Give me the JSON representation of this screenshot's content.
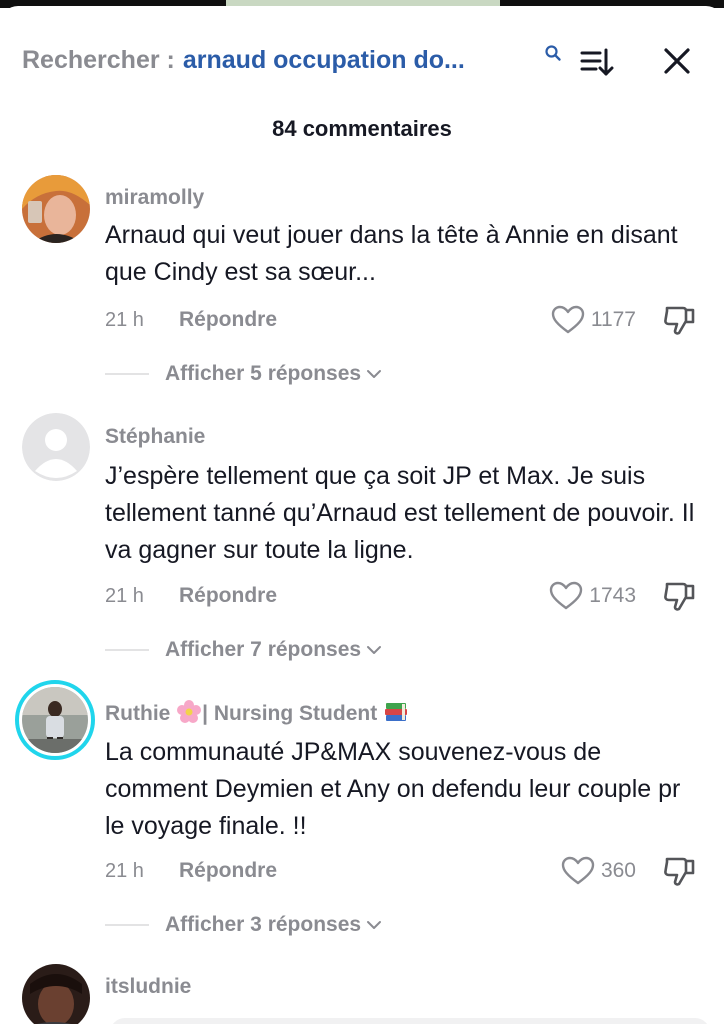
{
  "header": {
    "search_prefix": "Rechercher :",
    "search_query": "arnaud occupation do...",
    "comment_count": "84 commentaires"
  },
  "comments": [
    {
      "author": "miramolly",
      "text": "Arnaud qui veut jouer dans la tête à Annie en disant que Cindy est sa sœur...",
      "time": "21 h",
      "reply_label": "Répondre",
      "likes": "1177",
      "replies_label": "Afficher 5 réponses"
    },
    {
      "author": "Stéphanie",
      "text": "J’espère tellement que ça soit JP et Max. Je suis tellement tanné qu’Arnaud est tellement de pouvoir. Il va gagner sur toute la ligne.",
      "time": "21 h",
      "reply_label": "Répondre",
      "likes": "1743",
      "replies_label": "Afficher 7 réponses"
    },
    {
      "author_part1": "Ruthie ",
      "author_part2": "| Nursing Student ",
      "text": "La communauté JP&MAX souvenez-vous de comment Deymien et Any on defendu leur couple pr le voyage finale. !!",
      "time": "21 h",
      "reply_label": "Répondre",
      "likes": "360",
      "replies_label": "Afficher 3 réponses"
    },
    {
      "author": "itsludnie"
    }
  ],
  "colors": {
    "muted_text": "#8a8b91",
    "query_blue": "#2b5ca8",
    "story_ring": "#20d5ec"
  },
  "icons": [
    "search-icon",
    "sort-icon",
    "close-icon",
    "heart-icon",
    "dislike-icon",
    "chevron-down-icon",
    "flower-emoji",
    "books-emoji"
  ]
}
